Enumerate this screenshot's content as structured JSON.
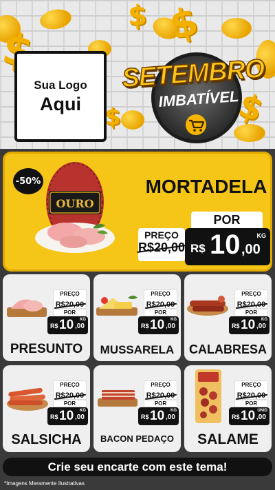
{
  "header": {
    "logo_line1": "Sua Logo",
    "logo_line2": "Aqui",
    "campaign_title": "SETEMBRO",
    "campaign_subtitle": "IMBATÍVEL",
    "cart_icon": "shopping-cart-icon"
  },
  "featured": {
    "discount": "-50%",
    "name": "MORTADELA",
    "brand": "OURO",
    "old_label": "PREÇO",
    "old_price": "R$20,00",
    "new_label": "POR",
    "currency": "R$",
    "price_int": "10",
    "price_dec": ",00",
    "unit": "KG"
  },
  "products": [
    {
      "name": "PRESUNTO",
      "old_label": "PREÇO",
      "old_price": "R$20,00",
      "new_label": "POR",
      "currency": "R$",
      "price_int": "10",
      "price_dec": ",00",
      "unit": "KG"
    },
    {
      "name": "MUSSARELA",
      "old_label": "PREÇO",
      "old_price": "R$20,00",
      "new_label": "POR",
      "currency": "R$",
      "price_int": "10",
      "price_dec": ",00",
      "unit": "KG"
    },
    {
      "name": "CALABRESA",
      "old_label": "PREÇO",
      "old_price": "R$20,00",
      "new_label": "POR",
      "currency": "R$",
      "price_int": "10",
      "price_dec": ",00",
      "unit": "KG"
    },
    {
      "name": "SALSICHA",
      "old_label": "PREÇO",
      "old_price": "R$20,00",
      "new_label": "POR",
      "currency": "R$",
      "price_int": "10",
      "price_dec": ",00",
      "unit": "KG"
    },
    {
      "name": "BACON PEDAÇO",
      "old_label": "PREÇO",
      "old_price": "R$20,00",
      "new_label": "POR",
      "currency": "R$",
      "price_int": "10",
      "price_dec": ",00",
      "unit": "KG"
    },
    {
      "name": "SALAME",
      "old_label": "PREÇO",
      "old_price": "R$20,00",
      "new_label": "POR",
      "currency": "R$",
      "price_int": "10",
      "price_dec": ",00",
      "unit": "UNID"
    }
  ],
  "footer": {
    "cta": "Crie seu encarte com este tema!",
    "disclaimer": "*Imagens Meramente Ilustrativas"
  },
  "colors": {
    "accent_yellow": "#f5c518",
    "dark": "#111111",
    "card_bg": "#efefef",
    "page_bg": "#3a3a3a"
  }
}
